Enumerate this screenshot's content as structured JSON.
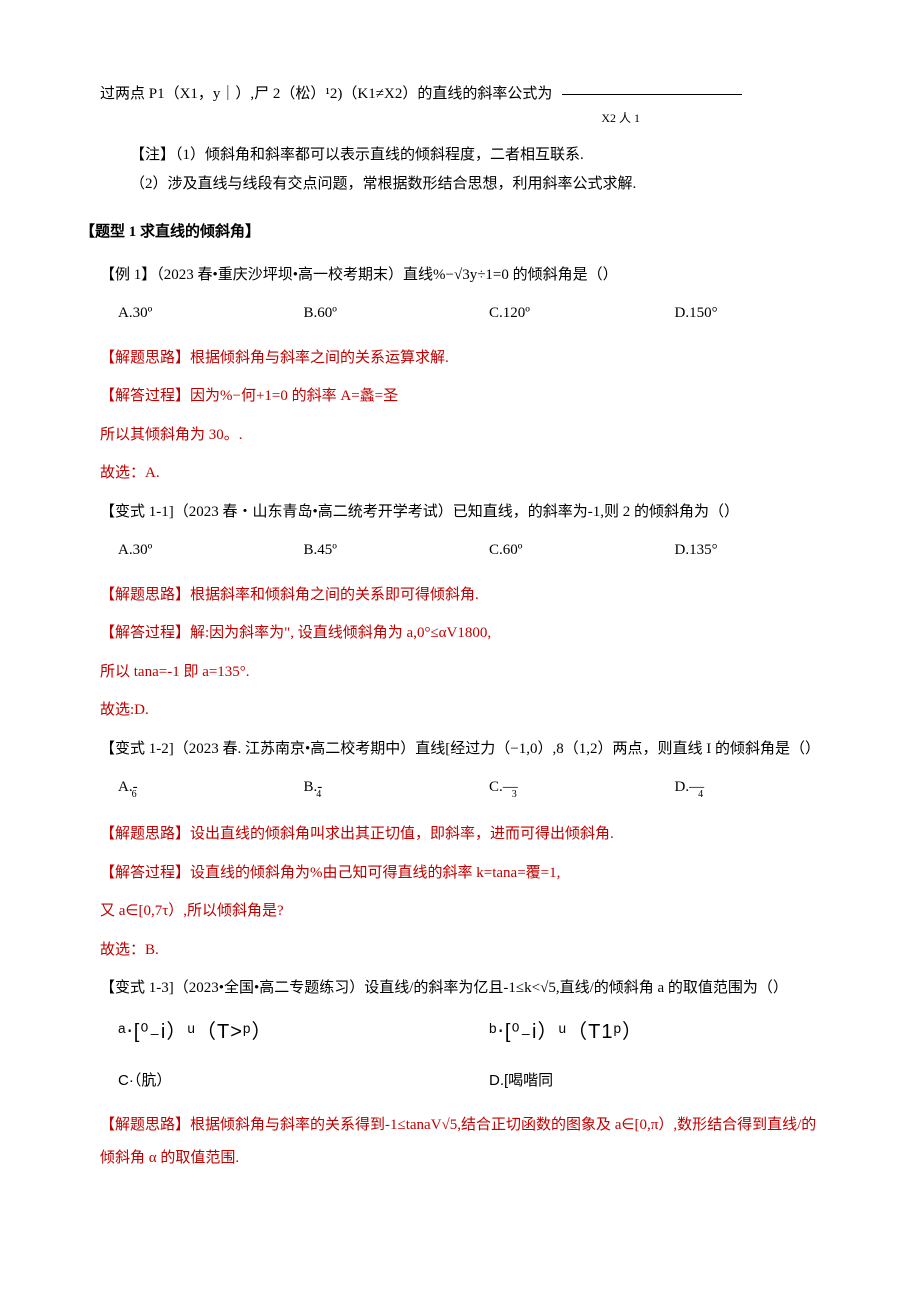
{
  "intro": {
    "formula_line": "过两点 P1（X1，y｜）,尸 2（松）¹2)（K1≠X2）的直线的斜率公式为",
    "denom": "X2 人 1"
  },
  "notes": {
    "note1": "【注】（1）倾斜角和斜率都可以表示直线的倾斜程度，二者相互联系.",
    "note2": "（2）涉及直线与线段有交点问题，常根据数形结合思想，利用斜率公式求解."
  },
  "section_head": "【题型 1 求直线的倾斜角】",
  "ex1": {
    "stem": "【例 1】（2023 春•重庆沙坪坝•高一校考期末）直线%−√3y÷1=0 的倾斜角是（）",
    "opts": {
      "a": "A.30º",
      "b": "B.60º",
      "c": "C.120º",
      "d": "D.150°"
    },
    "sol1": "【解题思路】根据倾斜角与斜率之间的关系运算求解.",
    "sol2": "【解答过程】因为%−何+1=0 的斜率 A=蠡=圣",
    "sol3": "所以其倾斜角为 30。.",
    "ans": "故选：A."
  },
  "v11": {
    "stem": "【变式 1-1]（2023 春・山东青岛•高二统考开学考试）已知直线，的斜率为-1,则 2 的倾斜角为（）",
    "opts": {
      "a": "A.30º",
      "b": "B.45º",
      "c": "C.60º",
      "d": "D.135°"
    },
    "sol1": "【解题思路】根据斜率和倾斜角之间的关系即可得倾斜角.",
    "sol2": "【解答过程】解:因为斜率为\", 设直线倾斜角为 a,0°≤αV1800,",
    "sol3": "所以 tana=-1 即 a=135°.",
    "ans": "故选:D."
  },
  "v12": {
    "stem": "【变式 1-2]（2023 春. 江苏南京•高二校考期中）直线[经过力（−1,0）,8（1,2）两点，则直线 I 的倾斜角是（）",
    "opts": {
      "a_main": "A.-",
      "a_sub": "6",
      "b_main": "B.-",
      "b_sub": "4",
      "c_main": "C.—",
      "c_sub": "3",
      "d_main": "D.—",
      "d_sub": "4"
    },
    "sol1": "【解题思路】设出直线的倾斜角叫求出其正切值，即斜率，进而可得出倾斜角.",
    "sol2": "【解答过程】设直线的倾斜角为%由己知可得直线的斜率 k=tana=覆=1,",
    "sol3": "又 a∈[0,7τ）,所以倾斜角是?",
    "ans": "故选：B."
  },
  "v13": {
    "stem": "【变式 1-3]（2023•全国•高二专题练习）设直线/的斜率为亿且-1≤k<√5,直线/的倾斜角 a 的取值范围为（）",
    "opts": {
      "a": "ᵃ‧[⁰₋i）ᵘ（T>ᵖ）",
      "b": "ᵇ‧[⁰₋i）ᵘ（T1ᵖ）",
      "c": "C·（肮）",
      "d": "D.[喝喈同"
    },
    "sol1a": "【解题思路】根据倾斜角与斜率的关系得到-1≤tanaV√5,结合正切函数的图象及 a∈[0,π）,数形结合得到直线/的",
    "sol1b": "倾斜角 α 的取值范围."
  }
}
